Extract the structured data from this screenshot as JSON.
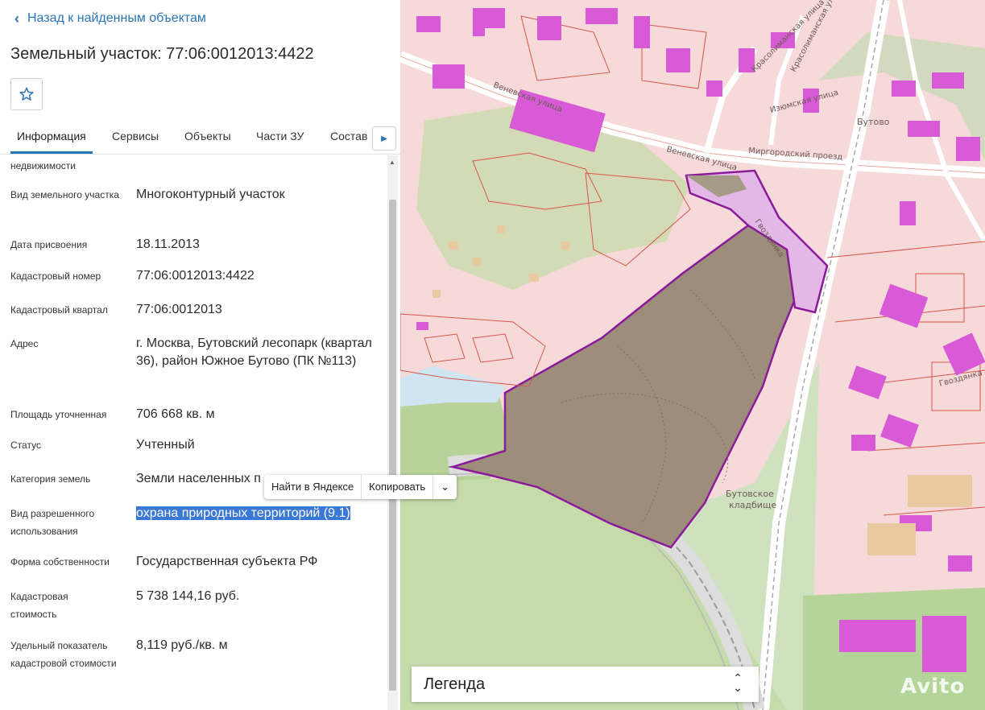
{
  "nav": {
    "back_label": "Назад к найденным объектам"
  },
  "object": {
    "title": "Земельный участок: 77:06:0012013:4422"
  },
  "tabs": [
    {
      "label": "Информация",
      "active": true
    },
    {
      "label": "Сервисы"
    },
    {
      "label": "Объекты"
    },
    {
      "label": "Части ЗУ"
    },
    {
      "label": "Состав"
    }
  ],
  "info_partial_label": "недвижимости",
  "fields": [
    {
      "label": "Вид земельного участка",
      "value": "Многоконтурный участок"
    },
    {
      "label": "Дата присвоения",
      "value": "18.11.2013"
    },
    {
      "label": "Кадастровый номер",
      "value": "77:06:0012013:4422"
    },
    {
      "label": "Кадастровый квартал",
      "value": "77:06:0012013"
    },
    {
      "label": "Адрес",
      "value": "г. Москва, Бутовский лесопарк (квартал 36), район Южное Бутово (ПК №113)"
    },
    {
      "label": "Площадь уточненная",
      "value": "706 668 кв. м"
    },
    {
      "label": "Статус",
      "value": "Учтенный"
    },
    {
      "label": "Категория земель",
      "value": "Земли населенных п"
    },
    {
      "label": "Вид разрешенного использования",
      "value": "охрана природных территорий (9.1)"
    },
    {
      "label": "Форма собственности",
      "value": "Государственная субъекта РФ"
    },
    {
      "label": "Кадастровая стоимость",
      "value": "5 738 144,16 руб."
    },
    {
      "label": "Удельный показатель кадастровой стоимости",
      "value": "8,119 руб./кв. м"
    }
  ],
  "context_menu": {
    "search_label": "Найти в Яндексе",
    "copy_label": "Копировать"
  },
  "map": {
    "labels": {
      "venevskaya1": "Веневская улица",
      "venevskaya2": "Веневская улица",
      "mirgorod": "Миргородский проезд",
      "butovo": "Бутово",
      "cemetery1": "Бутовское",
      "cemetery2": "кладбище",
      "gvozdyanka": "Гвоздянка",
      "krasolim": "Красолиманская улица",
      "ienskaya": "Изюмская улица",
      "kras2": "Красолиманская улица",
      "chyernoi": "Гвоздянка"
    },
    "legend_label": "Легенда"
  },
  "watermark": "Avito",
  "colors": {
    "accent": "#2a74b8",
    "parcel_fill": "#9a8b78",
    "parcel_border": "#8b1a9a",
    "building": "#d85ad6",
    "forest": "#b7cf9a"
  }
}
